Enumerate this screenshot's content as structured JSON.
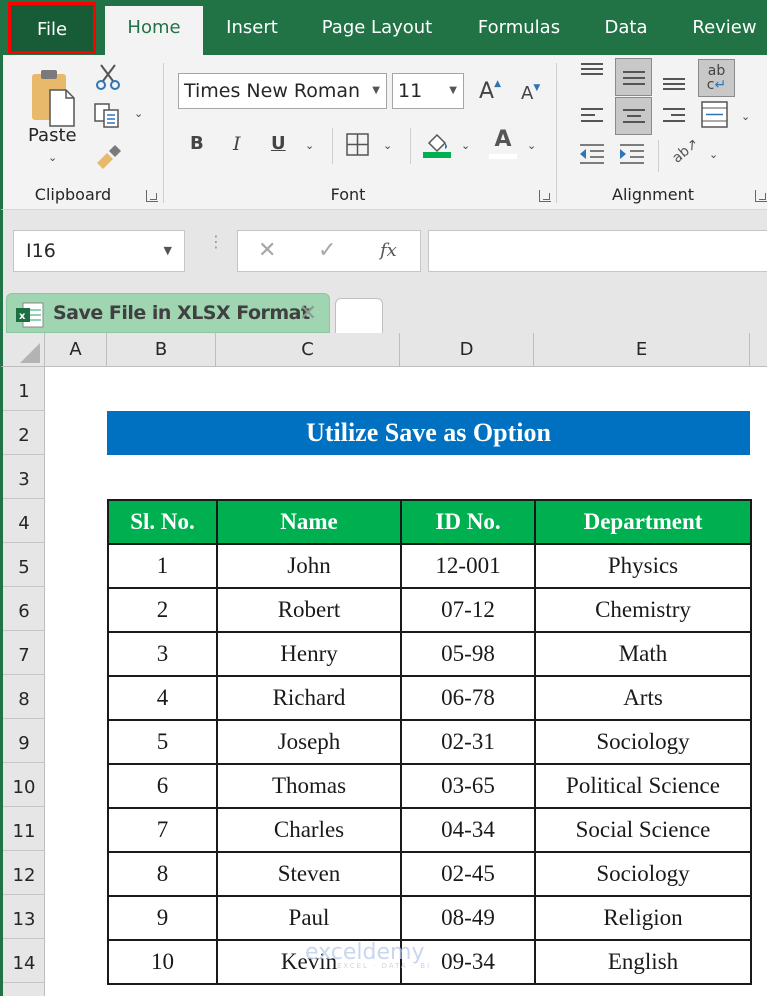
{
  "ribbon_tabs": [
    "File",
    "Home",
    "Insert",
    "Page Layout",
    "Formulas",
    "Data",
    "Review"
  ],
  "active_tab": "Home",
  "highlighted_tab": "File",
  "clipboard": {
    "group_label": "Clipboard",
    "paste_label": "Paste",
    "icons": [
      "paste-icon",
      "cut-icon",
      "copy-icon",
      "format-painter-icon"
    ]
  },
  "font": {
    "group_label": "Font",
    "font_name": "Times New Roman",
    "font_size": "11",
    "bold": "B",
    "italic": "I",
    "underline": "U",
    "grow": "A",
    "shrink": "A",
    "font_color_glyph": "A",
    "fill_color": "#00b050",
    "font_color": "#ffffff"
  },
  "alignment": {
    "group_label": "Alignment",
    "wrap_glyph": "ab\nc"
  },
  "formula_bar": {
    "name_box": "I16",
    "cancel": "✕",
    "enter": "✓",
    "fx": "fx",
    "formula": ""
  },
  "sheet_tab": {
    "label": "Save File in XLSX Format",
    "close": "✕"
  },
  "columns": [
    "A",
    "B",
    "C",
    "D",
    "E"
  ],
  "rows": [
    "1",
    "2",
    "3",
    "4",
    "5",
    "6",
    "7",
    "8",
    "9",
    "10",
    "11",
    "12",
    "13",
    "14"
  ],
  "sheet": {
    "title": "Utilize Save as Option",
    "title_color": "#0070c0",
    "header_color": "#00b050",
    "headers": [
      "Sl. No.",
      "Name",
      "ID No.",
      "Department"
    ],
    "records": [
      [
        "1",
        "John",
        "12-001",
        "Physics"
      ],
      [
        "2",
        "Robert",
        "07-12",
        "Chemistry"
      ],
      [
        "3",
        "Henry",
        "05-98",
        "Math"
      ],
      [
        "4",
        "Richard",
        "06-78",
        "Arts"
      ],
      [
        "5",
        "Joseph",
        "02-31",
        "Sociology"
      ],
      [
        "6",
        "Thomas",
        "03-65",
        "Political Science"
      ],
      [
        "7",
        "Charles",
        "04-34",
        "Social Science"
      ],
      [
        "8",
        "Steven",
        "02-45",
        "Sociology"
      ],
      [
        "9",
        "Paul",
        "08-49",
        "Religion"
      ],
      [
        "10",
        "Kevin",
        "09-34",
        "English"
      ]
    ]
  },
  "watermark": {
    "text": "exceldemy",
    "tagline": "EXCEL · DATA · BI"
  }
}
